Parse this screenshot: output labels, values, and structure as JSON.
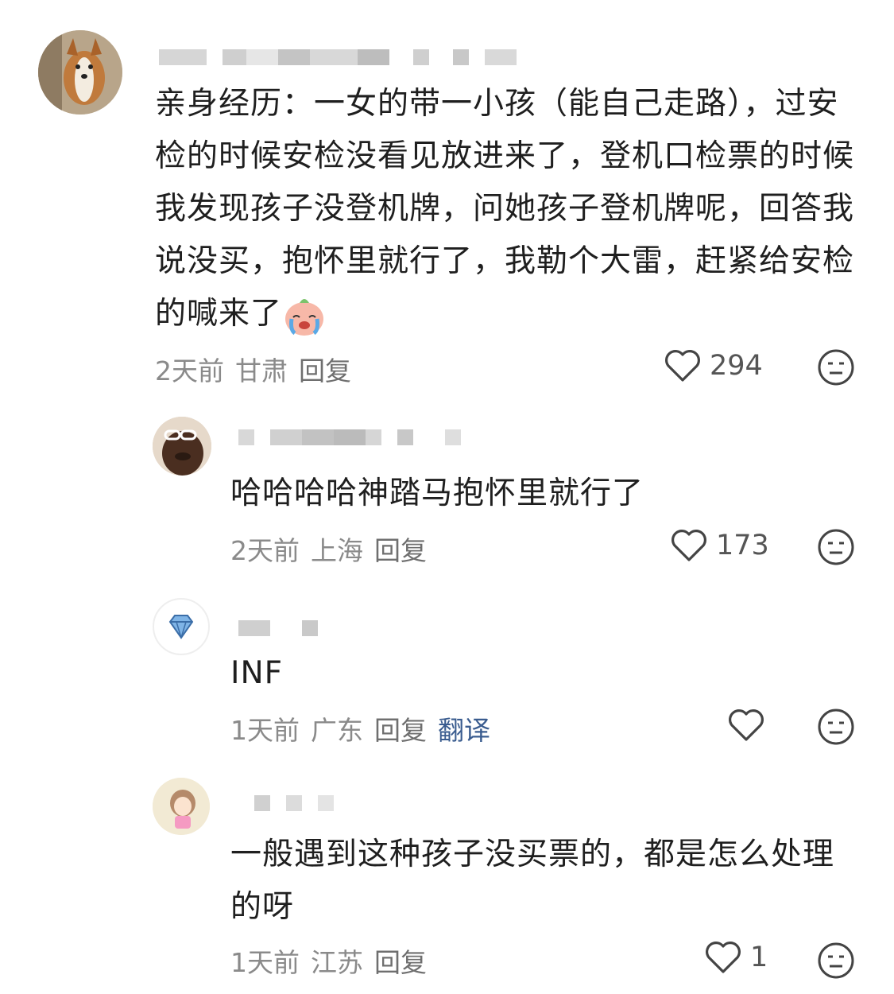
{
  "comments": [
    {
      "text": "亲身经历：一女的带一小孩（能自己走路），过安检的时候安检没看见放进来了，登机口检票的时候我发现孩子没登机牌，问她孩子登机牌呢，回答我说没买，抱怀里就行了，我勒个大雷，赶紧给安检的喊来了",
      "time": "2天前",
      "location": "甘肃",
      "reply": "回复",
      "likes": "294"
    },
    {
      "text": "哈哈哈哈神踏马抱怀里就行了",
      "time": "2天前",
      "location": "上海",
      "reply": "回复",
      "likes": "173"
    },
    {
      "text": "INF",
      "time": "1天前",
      "location": "广东",
      "reply": "回复",
      "translate": "翻译",
      "likes": ""
    },
    {
      "text": "一般遇到这种孩子没买票的，都是怎么处理的呀",
      "time": "1天前",
      "location": "江苏",
      "reply": "回复",
      "likes": "1"
    }
  ]
}
